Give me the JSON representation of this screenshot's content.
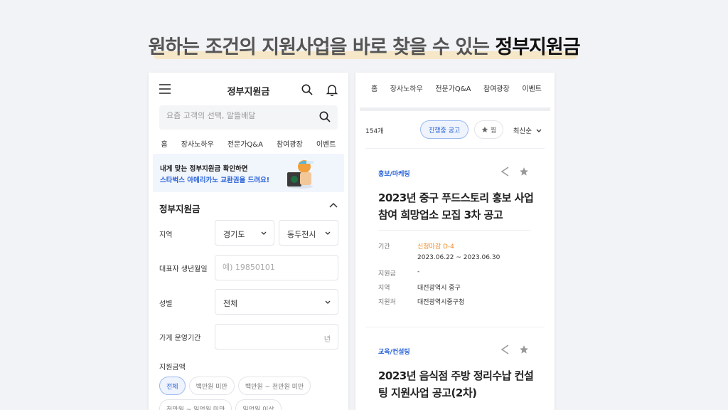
{
  "headline": {
    "text": "원하는 조건의 지원사업을 바로 찾을 수 있는 ",
    "accent": "정부지원금"
  },
  "left_screen": {
    "app_title": "정부지원금",
    "search_placeholder": "요즘 고객의 선택, 알뜰배달",
    "nav": [
      "홈",
      "장사노하우",
      "전문가Q&A",
      "참여광장",
      "이벤트"
    ],
    "banner": {
      "line1": "내게 맞는 정부지원금 확인하면",
      "line2": "스타벅스 아메리카노 교환권을 드려요!"
    },
    "filter": {
      "section_title": "정부지원금",
      "region_label": "지역",
      "region_province": "경기도",
      "region_city": "동두천시",
      "birth_label": "대표자 생년월일",
      "birth_placeholder": "예) 19850101",
      "gender_label": "성별",
      "gender_value": "전체",
      "period_label": "가게 운영기간",
      "period_unit": "년",
      "amount_label": "지원금액",
      "amount_chips": [
        "전체",
        "백만원 미만",
        "백만원 ~ 천만원 미만",
        "천만원 ~ 일억원 미만",
        "일억원 이상"
      ],
      "amount_selected_index": 0
    }
  },
  "right_screen": {
    "nav": [
      "홈",
      "장사노하우",
      "전문가Q&A",
      "참여광장",
      "이벤트"
    ],
    "count": "154개",
    "filter_active": "진행중 공고",
    "filter_fav": "찜",
    "sort": "최신순",
    "cards": [
      {
        "category": "홍보/마케팅",
        "title": "2023년 중구 푸드스토리 홍보 사업 참여 희망업소 모집 3차 공고",
        "period_label": "기간",
        "deadline": "신청마감 D-4",
        "period": "2023.06.22 ~ 2023.06.30",
        "amount_label": "지원금",
        "amount": "-",
        "region_label": "지역",
        "region": "대전광역시 중구",
        "org_label": "지원처",
        "org": "대전광역시중구청"
      },
      {
        "category": "교육/컨설팅",
        "title": "2023년 음식점 주방 정리수납 컨설팅 지원사업 공고(2차)"
      }
    ]
  },
  "colors": {
    "accent_blue": "#2762d8",
    "deadline_orange": "#f08a24",
    "background": "#f2f3f6",
    "headline_highlight": "#f6e7c8"
  }
}
